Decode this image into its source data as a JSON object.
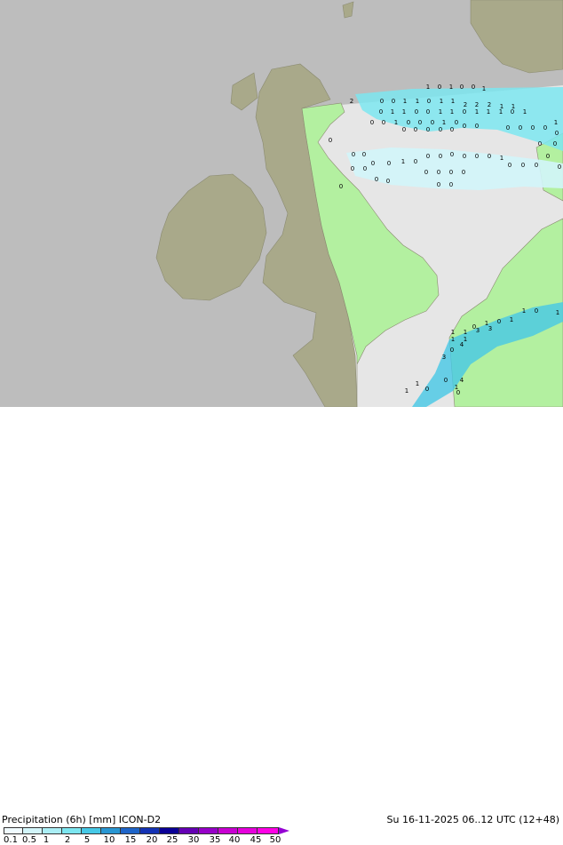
{
  "title": "Precipitation (6h) [mm] ICON-D2",
  "datetime": "Su 16-11-2025 06..12 UTC (12+48)",
  "colors": {
    "sea": "#e6e6e6",
    "land_outside_domain": "#a9a98a",
    "land_domain": "#b3f0a0",
    "outside_domain_sea": "#bdbdbd",
    "coast_line": "#8a8a70"
  },
  "legend": {
    "labels": [
      "0.1",
      "0.5",
      "1",
      "2",
      "5",
      "10",
      "15",
      "20",
      "25",
      "30",
      "35",
      "40",
      "45",
      "50"
    ],
    "colors": [
      "#f0fbff",
      "#d2f5fa",
      "#aaeef5",
      "#7ce6f0",
      "#46c8e6",
      "#2896d2",
      "#1e64c8",
      "#1432b4",
      "#0a0096",
      "#6400b4",
      "#9600c8",
      "#c800d2",
      "#e600dc",
      "#ff00e6"
    ]
  },
  "precip_labels": [
    {
      "t": "2"
    },
    {
      "t": "1"
    },
    {
      "t": "0"
    },
    {
      "t": "1"
    },
    {
      "t": "0"
    },
    {
      "t": "0"
    },
    {
      "t": "1"
    },
    {
      "t": "0"
    },
    {
      "t": "0"
    },
    {
      "t": "1"
    },
    {
      "t": "1"
    },
    {
      "t": "0"
    },
    {
      "t": "1"
    },
    {
      "t": "1"
    },
    {
      "t": "2"
    },
    {
      "t": "2"
    },
    {
      "t": "2"
    },
    {
      "t": "1"
    },
    {
      "t": "1"
    },
    {
      "t": "0"
    },
    {
      "t": "1"
    },
    {
      "t": "1"
    },
    {
      "t": "0"
    },
    {
      "t": "0"
    },
    {
      "t": "1"
    },
    {
      "t": "1"
    },
    {
      "t": "0"
    },
    {
      "t": "1"
    },
    {
      "t": "1"
    },
    {
      "t": "1"
    },
    {
      "t": "0"
    },
    {
      "t": "1"
    },
    {
      "t": "0"
    },
    {
      "t": "0"
    },
    {
      "t": "1"
    },
    {
      "t": "0"
    },
    {
      "t": "0"
    },
    {
      "t": "0"
    },
    {
      "t": "1"
    },
    {
      "t": "0"
    },
    {
      "t": "0"
    },
    {
      "t": "0"
    },
    {
      "t": "0"
    },
    {
      "t": "0"
    },
    {
      "t": "0"
    },
    {
      "t": "0"
    },
    {
      "t": "0"
    },
    {
      "t": "0"
    },
    {
      "t": "0"
    },
    {
      "t": "0"
    },
    {
      "t": "0"
    },
    {
      "t": "1"
    },
    {
      "t": "0"
    },
    {
      "t": "0"
    },
    {
      "t": "0"
    },
    {
      "t": "0"
    },
    {
      "t": "0"
    },
    {
      "t": "0"
    },
    {
      "t": "0"
    },
    {
      "t": "0"
    },
    {
      "t": "1"
    },
    {
      "t": "0"
    },
    {
      "t": "0"
    },
    {
      "t": "0"
    },
    {
      "t": "0"
    },
    {
      "t": "0"
    },
    {
      "t": "0"
    },
    {
      "t": "0"
    },
    {
      "t": "0"
    },
    {
      "t": "0"
    },
    {
      "t": "1"
    },
    {
      "t": "0"
    },
    {
      "t": "0"
    },
    {
      "t": "0"
    },
    {
      "t": "0"
    },
    {
      "t": "0"
    },
    {
      "t": "0"
    },
    {
      "t": "0"
    },
    {
      "t": "0"
    },
    {
      "t": "0"
    },
    {
      "t": "0"
    },
    {
      "t": "0"
    },
    {
      "t": "0"
    },
    {
      "t": "0"
    },
    {
      "t": "0"
    },
    {
      "t": "0"
    },
    {
      "t": "1"
    },
    {
      "t": "0"
    },
    {
      "t": "1"
    },
    {
      "t": "1"
    },
    {
      "t": "0"
    },
    {
      "t": "1"
    },
    {
      "t": "1"
    },
    {
      "t": "3"
    },
    {
      "t": "3"
    },
    {
      "t": "4"
    },
    {
      "t": "1"
    },
    {
      "t": "1"
    },
    {
      "t": "3"
    },
    {
      "t": "0"
    },
    {
      "t": "1"
    },
    {
      "t": "0"
    },
    {
      "t": "1"
    },
    {
      "t": "0"
    },
    {
      "t": "1"
    },
    {
      "t": "4"
    },
    {
      "t": "0"
    },
    {
      "t": "1"
    },
    {
      "t": "2"
    }
  ]
}
